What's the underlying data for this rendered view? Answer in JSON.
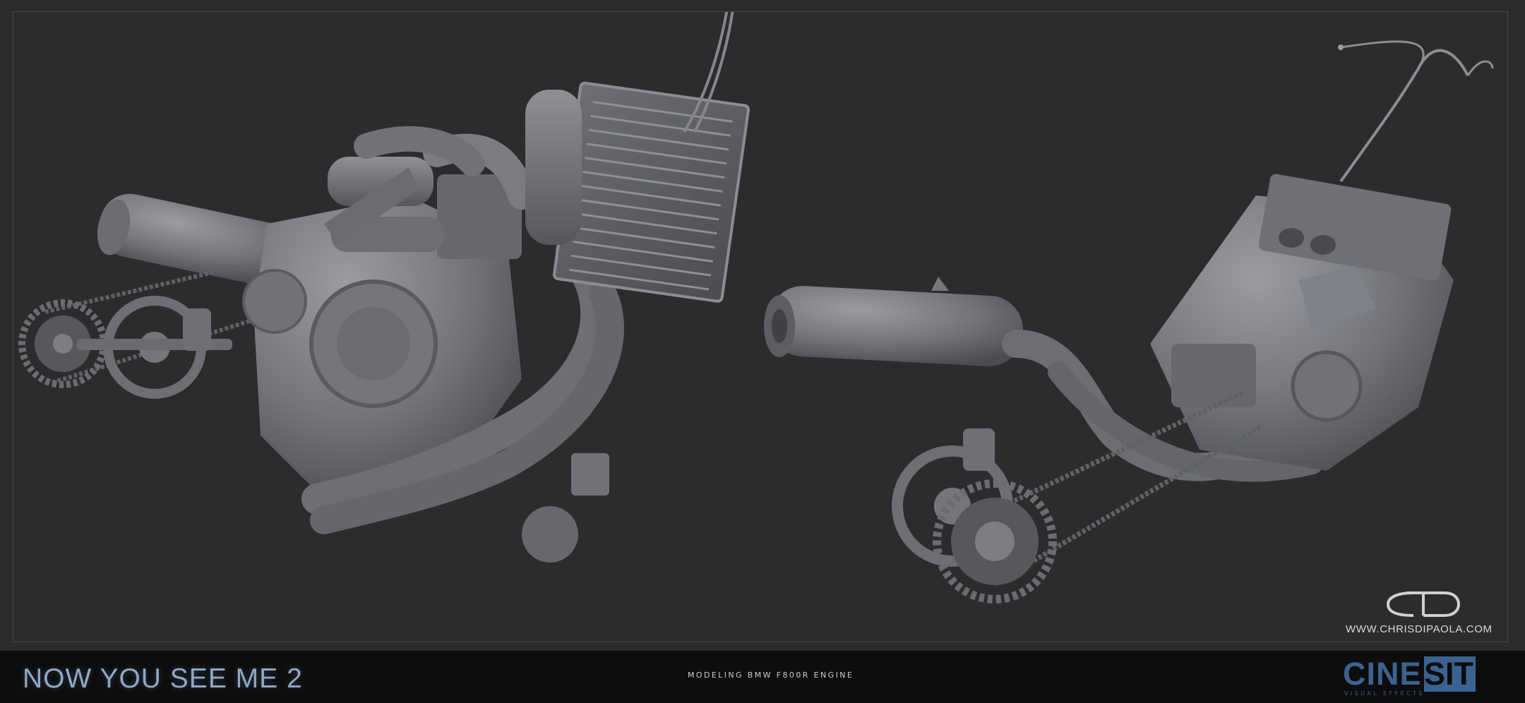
{
  "movie_title": "NOW YOU SEE ME",
  "movie_title_number": "2",
  "caption": "MODELING BMW F800R ENGINE",
  "website": "WWW.CHRISDIPAOLA.COM",
  "studio": {
    "name_left": "CINE",
    "name_right": "SITE",
    "tagline": "VISUAL EFFECTS"
  },
  "artist_logo_icon": "cd-monogram-logo",
  "colors": {
    "background": "#2c2c2c",
    "bar": "#0d0d0d",
    "clay": "#7a7c82",
    "studio_blue": "#3b6391",
    "title_blue": "#8fa7c2"
  }
}
